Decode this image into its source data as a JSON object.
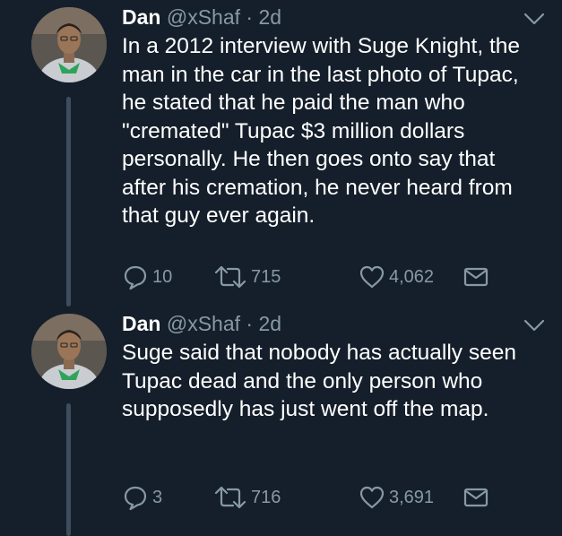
{
  "tweets": [
    {
      "author": {
        "name": "Dan",
        "handle": "@xShaf",
        "time": "2d"
      },
      "text": "In a 2012 interview with Suge Knight, the man in the car in the last photo of Tupac, he stated that he paid the man who \"cremated\" Tupac $3 million dollars personally. He then goes onto say that after his cremation, he never heard from that guy ever again.",
      "stats": {
        "replies": "10",
        "retweets": "715",
        "likes": "4,062"
      }
    },
    {
      "author": {
        "name": "Dan",
        "handle": "@xShaf",
        "time": "2d"
      },
      "text": "Suge said that nobody has actually seen Tupac dead and the only person who supposedly has just went off the map.",
      "stats": {
        "replies": "3",
        "retweets": "716",
        "likes": "3,691"
      }
    }
  ],
  "separator": "·",
  "icons": [
    "reply-icon",
    "retweet-icon",
    "like-icon",
    "direct-message-icon",
    "chevron-down-icon"
  ],
  "colors": {
    "background": "#151f2b",
    "text": "#ffffff",
    "secondary_text": "#8899a6",
    "thread_line": "#3d4d5e"
  }
}
